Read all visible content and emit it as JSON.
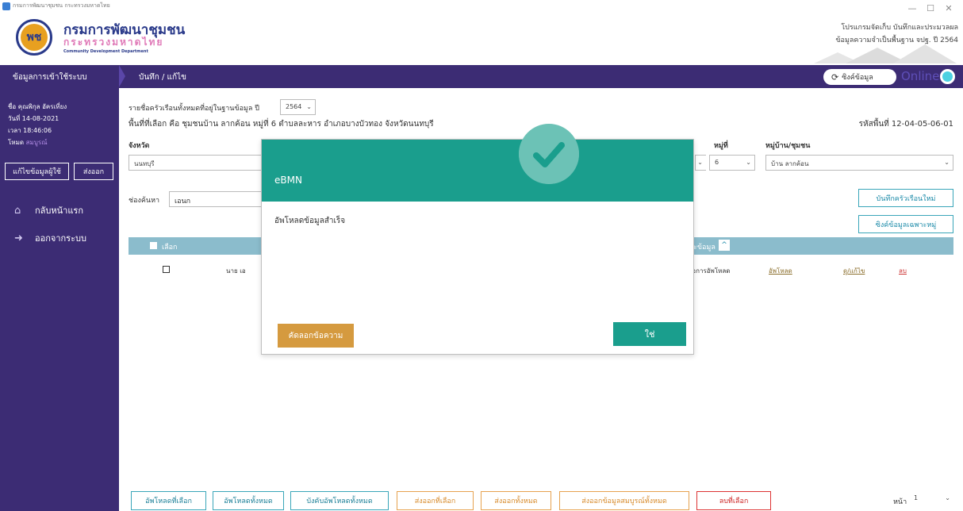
{
  "window": {
    "title": "กรมการพัฒนาชุมชน กระทรวงมหาดไทย",
    "minimize": "—",
    "maximize": "☐",
    "close": "✕"
  },
  "header": {
    "logo_text": "พช",
    "org_name": "กรมการพัฒนาชุมชน",
    "org_sub": "กระทรวงมหาดไทย",
    "org_en": "Community Development Department",
    "system_line1": "โปรแกรมจัดเก็บ บันทึกและประมวลผล",
    "system_line2": "ข้อมูลความจำเป็นพื้นฐาน จปฐ. ปี 2564"
  },
  "navbar": {
    "left_label": "ข้อมูลการเข้าใช้ระบบ",
    "title": "บันทึก / แก้ไข",
    "sync_label": "ซิงค์ข้อมูล",
    "online_label": "Online"
  },
  "sidebar": {
    "name": "ชื่อ คุณพิกุล อัครเที่ยง",
    "date": "วันที่ 14-08-2021",
    "time": "เวลา 18:46:06",
    "mode_label": "โหมด",
    "mode_value": "สมบูรณ์",
    "edit_user_btn": "แก้ไขข้อมูลผู้ใช้",
    "export_btn": "ส่งออก",
    "home": "กลับหน้าแรก",
    "logout": "ออกจากระบบ"
  },
  "main": {
    "year_label": "รายชื่อครัวเรือนทั้งหมดที่อยู่ในฐานข้อมูล ปี",
    "year_value": "2564",
    "area_text": "พื้นที่ที่เลือก คือ ชุมชนบ้าน ลากค้อน หมู่ที่ 6 ตำบลละหาร อำเภอบางบัวทอง จังหวัดนนทบุรี",
    "area_code": "รหัสพื้นที่ 12-04-05-06-01",
    "province_label": "จังหวัด",
    "province_value": "นนทบุรี",
    "moo_label": "หมู่ที่",
    "moo_value": "6",
    "village_label": "หมู่บ้าน/ชุมชน",
    "village_value": "บ้าน ลากค้อน",
    "search_label": "ช่องค้นหา",
    "search_value": "เอนก",
    "btn_new_household": "บันทึกครัวเรือนใหม่",
    "btn_sync_moo": "ซิงค์ข้อมูลเฉพาะหมู่",
    "col_select": "เลือก",
    "col_status": "ะข้อมูล",
    "sort_icon": "^",
    "row": {
      "name": "นาย เอ",
      "status": "รอการอัพโหลด",
      "upload": "อัพโหลด",
      "view_edit": "ดู/แก้ไข",
      "delete": "ลบ"
    },
    "bottom_buttons": [
      "อัพโหลดที่เลือก",
      "อัพโหลดทั้งหมด",
      "บังคับอัพโหลดทั้งหมด",
      "ส่งออกที่เลือก",
      "ส่งออกทั้งหมด",
      "ส่งออกข้อมูลสมบูรณ์ทั้งหมด",
      "ลบที่เลือก"
    ],
    "page_label": "หน้า",
    "page_value": "1"
  },
  "modal": {
    "title": "eBMN",
    "message": "อัพโหลดข้อมูลสำเร็จ",
    "copy_btn": "คัดลอกข้อความ",
    "ok_btn": "ใช่"
  },
  "colors": {
    "nav_purple": "#3c2c74",
    "teal": "#1a9e8d",
    "orange": "#d59a3f",
    "table_header": "#8bbccc"
  }
}
